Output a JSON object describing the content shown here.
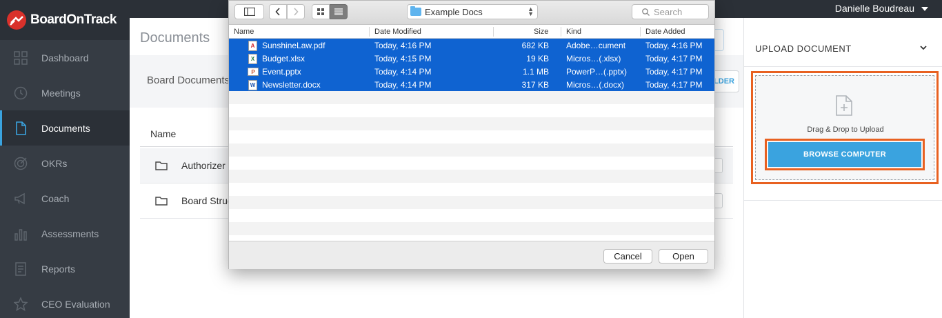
{
  "app": {
    "brand": "BoardOnTrack",
    "user_name": "Danielle Boudreau"
  },
  "sidebar": {
    "items": [
      {
        "label": "Dashboard",
        "icon": "grid-icon",
        "active": false
      },
      {
        "label": "Meetings",
        "icon": "clock-icon",
        "active": false
      },
      {
        "label": "Documents",
        "icon": "document-icon",
        "active": true
      },
      {
        "label": "OKRs",
        "icon": "target-icon",
        "active": false
      },
      {
        "label": "Coach",
        "icon": "megaphone-icon",
        "active": false
      },
      {
        "label": "Assessments",
        "icon": "bar-chart-icon",
        "active": false
      },
      {
        "label": "Reports",
        "icon": "report-icon",
        "active": false
      },
      {
        "label": "CEO Evaluation",
        "icon": "star-icon",
        "active": false
      }
    ]
  },
  "main": {
    "title": "Documents",
    "board_title": "Board Documents",
    "folder_button_label": "LDER",
    "name_column": "Name",
    "rows": [
      {
        "name": "Authorizer I"
      },
      {
        "name": "Board Struc"
      }
    ]
  },
  "upload": {
    "title": "UPLOAD DOCUMENT",
    "drag_text": "Drag & Drop to Upload",
    "browse_label": "BROWSE COMPUTER"
  },
  "dialog": {
    "location": "Example Docs",
    "search_placeholder": "Search",
    "columns": {
      "name": "Name",
      "date_modified": "Date Modified",
      "size": "Size",
      "kind": "Kind",
      "date_added": "Date Added"
    },
    "files": [
      {
        "name": "SunshineLaw.pdf",
        "modified": "Today, 4:16 PM",
        "size": "682 KB",
        "kind": "Adobe…cument",
        "added": "Today, 4:16 PM",
        "type": "pdf"
      },
      {
        "name": "Budget.xlsx",
        "modified": "Today, 4:15 PM",
        "size": "19 KB",
        "kind": "Micros…(.xlsx)",
        "added": "Today, 4:17 PM",
        "type": "xlsx"
      },
      {
        "name": "Event.pptx",
        "modified": "Today, 4:14 PM",
        "size": "1.1 MB",
        "kind": "PowerP…(.pptx)",
        "added": "Today, 4:17 PM",
        "type": "pptx"
      },
      {
        "name": "Newsletter.docx",
        "modified": "Today, 4:14 PM",
        "size": "317 KB",
        "kind": "Micros…(.docx)",
        "added": "Today, 4:17 PM",
        "type": "docx"
      }
    ],
    "cancel_label": "Cancel",
    "open_label": "Open"
  },
  "colors": {
    "accent": "#3aa3df",
    "highlight": "#e86121",
    "selection": "#0f63d1",
    "sidebar": "#363c44"
  }
}
